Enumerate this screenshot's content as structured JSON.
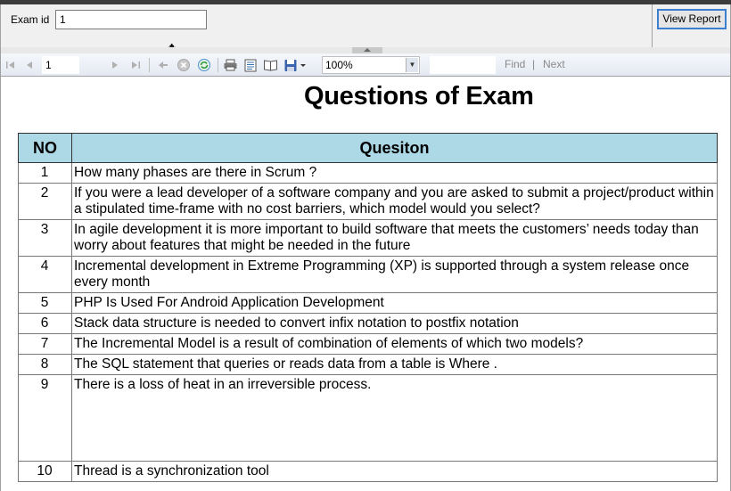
{
  "parameters": {
    "exam_id_label": "Exam id",
    "exam_id_value": "1",
    "view_report_label": "View Report"
  },
  "toolbar": {
    "current_page": "1",
    "zoom": "100%",
    "find_label": "Find",
    "separator": "|",
    "next_label": "Next",
    "icons": [
      "first-page-icon",
      "previous-page-icon",
      "next-page-icon",
      "last-page-icon",
      "back-icon",
      "stop-icon",
      "refresh-icon",
      "print-icon",
      "print-layout-icon",
      "page-setup-icon",
      "export-icon"
    ]
  },
  "report": {
    "title": "Questions of Exam",
    "columns": [
      "NO",
      "Quesiton"
    ],
    "rows": [
      {
        "no": "1",
        "question": "How many phases are there in Scrum ?"
      },
      {
        "no": "2",
        "question": "If you were a lead developer of a software company and you are asked to submit a project/product within a stipulated time-frame with no cost barriers, which model would you select?"
      },
      {
        "no": "3",
        "question": "In agile development it is more important to build software that meets the customers’ needs today than worry about features that might be needed in the future"
      },
      {
        "no": "4",
        "question": "Incremental development in Extreme Programming (XP) is supported through a system release once every month"
      },
      {
        "no": "5",
        "question": "PHP Is Used For Android Application Development"
      },
      {
        "no": "6",
        "question": "Stack data structure is needed to convert infix notation to postfix notation"
      },
      {
        "no": "7",
        "question": "The Incremental Model is a result of combination of elements of which two models?"
      },
      {
        "no": "8",
        "question": "The SQL statement that queries or reads data from a table is  Where ."
      },
      {
        "no": "9",
        "question": "There is a loss of heat in an irreversible process."
      },
      {
        "no": "10",
        "question": "Thread is a synchronization tool"
      }
    ]
  }
}
